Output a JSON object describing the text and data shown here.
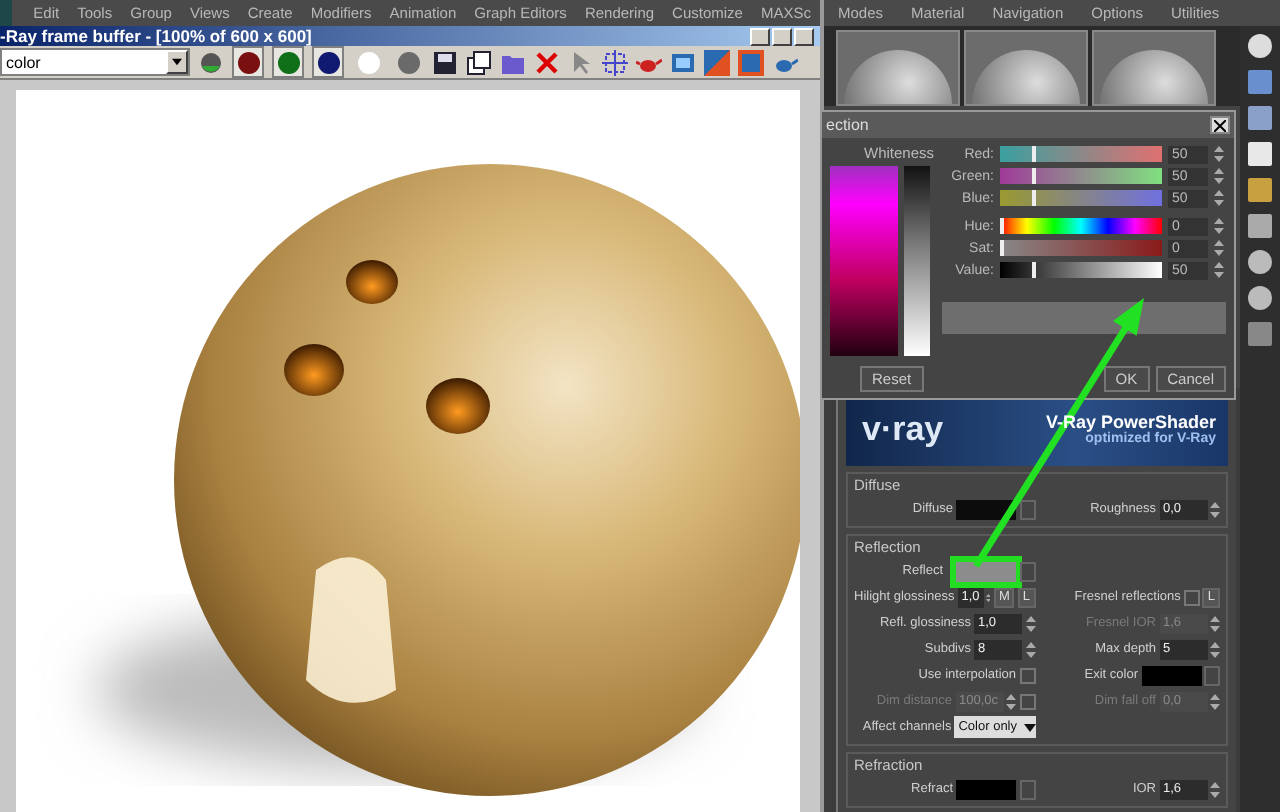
{
  "main_menu": [
    "Edit",
    "Tools",
    "Group",
    "Views",
    "Create",
    "Modifiers",
    "Animation",
    "Graph Editors",
    "Rendering",
    "Customize",
    "MAXSc"
  ],
  "frame_buffer": {
    "title": "-Ray frame buffer - [100% of 600 x 600]",
    "channel": "color",
    "channel_buttons": [
      {
        "color": "#7a1010",
        "selected": true
      },
      {
        "color": "#10701a",
        "selected": true
      },
      {
        "color": "#101a70",
        "selected": true
      },
      {
        "color": "#ffffff",
        "selected": false
      },
      {
        "color": "#6a6a6a",
        "selected": false
      }
    ]
  },
  "material_editor": {
    "menu": [
      "Modes",
      "Material",
      "Navigation",
      "Options",
      "Utilities"
    ]
  },
  "color_dialog": {
    "title": "ection",
    "whiteness_label": "Whiteness",
    "channels": [
      {
        "kind": "red",
        "label": "Red:",
        "level": 0.2,
        "value": "50"
      },
      {
        "kind": "green",
        "label": "Green:",
        "level": 0.2,
        "value": "50"
      },
      {
        "kind": "blue",
        "label": "Blue:",
        "level": 0.2,
        "value": "50"
      },
      {
        "kind": "hue",
        "label": "Hue:",
        "level": 0,
        "value": "0"
      },
      {
        "kind": "sat",
        "label": "Sat:",
        "level": 0,
        "value": "0"
      },
      {
        "kind": "value",
        "label": "Value:",
        "level": 0.2,
        "value": "50"
      }
    ],
    "buttons": [
      "Reset",
      "OK",
      "Cancel"
    ]
  },
  "powershader": {
    "logo": "v·ray",
    "title": "V-Ray PowerShader",
    "subtitle": "optimized for V-Ray"
  },
  "rollouts": [
    {
      "title": "Diffuse",
      "rows": [
        [
          {
            "kind": "swatch",
            "label": "Diffuse",
            "color": "#0c0c0c"
          },
          {
            "kind": "spinner",
            "label": "Roughness",
            "value": "0,0"
          }
        ]
      ]
    },
    {
      "title": "Reflection",
      "rows": [
        [
          {
            "kind": "swatch",
            "label": "Reflect",
            "color": "#8c8c8c",
            "highlighted": true
          }
        ],
        [
          {
            "kind": "spinner",
            "label": "Hilight glossiness",
            "value": "1,0",
            "buttons": [
              "M",
              "L"
            ]
          },
          {
            "kind": "checkbox",
            "label": "Fresnel reflections",
            "checked": false,
            "buttons": [
              "L"
            ]
          }
        ],
        [
          {
            "kind": "spinner",
            "label": "Refl. glossiness",
            "value": "1,0"
          },
          {
            "kind": "spinner",
            "label": "Fresnel IOR",
            "value": "1,6",
            "disabled": true
          }
        ],
        [
          {
            "kind": "spinner",
            "label": "Subdivs",
            "value": "8"
          },
          {
            "kind": "spinner",
            "label": "Max depth",
            "value": "5"
          }
        ],
        [
          {
            "kind": "checkbox",
            "label": "Use interpolation",
            "checked": false
          },
          {
            "kind": "swatch",
            "label": "Exit color",
            "color": "#000000"
          }
        ],
        [
          {
            "kind": "spinner",
            "label": "Dim distance",
            "value": "100,0c",
            "disabled": true,
            "checked": false
          },
          {
            "kind": "spinner",
            "label": "Dim fall off",
            "value": "0,0",
            "disabled": true
          }
        ],
        [
          {
            "kind": "dropdown",
            "label": "Affect channels",
            "value": "Color only"
          }
        ]
      ]
    },
    {
      "title": "Refraction",
      "rows": [
        [
          {
            "kind": "swatch",
            "label": "Refract",
            "color": "#000000"
          },
          {
            "kind": "spinner",
            "label": "IOR",
            "value": "1,6"
          }
        ]
      ]
    }
  ]
}
